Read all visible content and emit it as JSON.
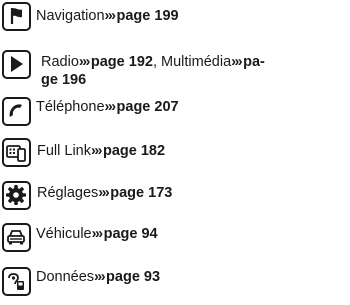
{
  "entries": [
    {
      "icon": "flag-icon",
      "label": "Navigation",
      "arrows": "›››",
      "ref": "page 199"
    },
    {
      "icon": "play-icon",
      "label": "Radio",
      "arrows": "›››",
      "ref": "page 192",
      "sep": ", ",
      "label2": "Multimédia",
      "arrows2": "›››",
      "ref2_line1": "pa-",
      "ref2_line2": "ge 196"
    },
    {
      "icon": "phone-icon",
      "label": "Téléphone",
      "arrows": "›››",
      "ref": "page 207"
    },
    {
      "icon": "full-link-icon",
      "label": "Full Link",
      "arrows": "›››",
      "ref": "page 182"
    },
    {
      "icon": "gear-icon",
      "label": "Réglages",
      "arrows": "›››",
      "ref": "page 173"
    },
    {
      "icon": "car-icon",
      "label": "Véhicule",
      "arrows": "›››",
      "ref": "page 94"
    },
    {
      "icon": "data-icon",
      "label": "Données",
      "arrows": "›››",
      "ref": "page 93"
    }
  ]
}
